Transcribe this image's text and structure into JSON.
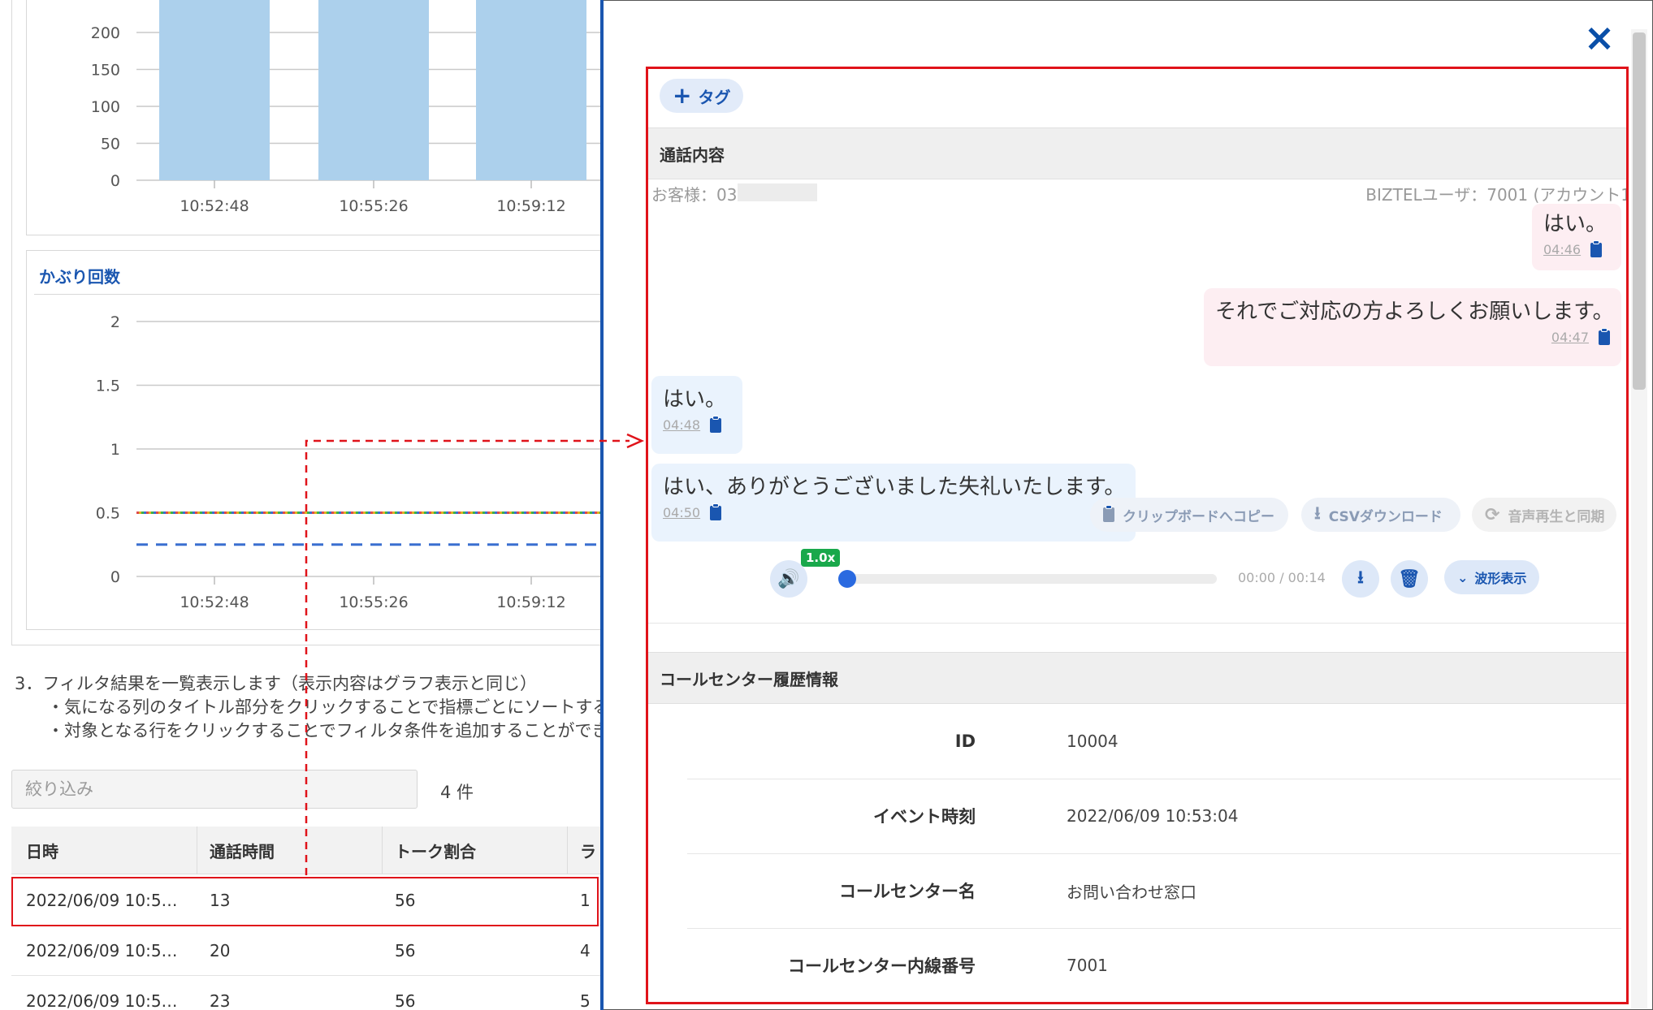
{
  "bar_chart": {
    "type": "bar",
    "yticks": [
      "200",
      "150",
      "100",
      "50",
      "0"
    ],
    "categories": [
      "10:52:48",
      "10:55:26",
      "10:59:12"
    ],
    "ylim": [
      0,
      200
    ],
    "bar_color": "#acd0ec"
  },
  "line_chart": {
    "type": "line",
    "title": "かぶり回数",
    "yticks": [
      "2",
      "1.5",
      "1",
      "0.5",
      "0"
    ],
    "categories": [
      "10:52:48",
      "10:55:26",
      "10:59:12"
    ],
    "ylim": [
      0,
      2
    ],
    "series": [
      {
        "style": "dotted-multicolor",
        "values": [
          0.5,
          0.5,
          0.5
        ]
      },
      {
        "style": "dashed",
        "color": "#3a6fd0",
        "values": [
          0.25,
          0.25,
          0.25
        ]
      }
    ]
  },
  "instructions": {
    "line1": "3．フィルタ結果を一覧表示します（表示内容はグラフ表示と同じ）",
    "line2": "・気になる列のタイトル部分をクリックすることで指標ごとにソートするこ",
    "line3": "・対象となる行をクリックすることでフィルタ条件を追加することができま"
  },
  "filter": {
    "placeholder": "絞り込み",
    "count": "4 件"
  },
  "table": {
    "headers": [
      "日時",
      "通話時間",
      "トーク割合",
      "ラ"
    ],
    "rows": [
      [
        "2022/06/09 10:5…",
        "13",
        "56",
        "1"
      ],
      [
        "2022/06/09 10:5…",
        "20",
        "56",
        "4"
      ],
      [
        "2022/06/09 10:5…",
        "23",
        "56",
        "5"
      ]
    ]
  },
  "modal": {
    "close_icon": "×",
    "tag_button": "タグ",
    "call_section_title": "通話内容",
    "customer_label": "お客様：03",
    "agent_label": "BIZTELユーザ：7001 (アカウント1",
    "messages": [
      {
        "speaker": "agent",
        "text": "はい。",
        "time": "04:46"
      },
      {
        "speaker": "agent",
        "text": "それでご対応の方よろしくお願いします。",
        "time": "04:47"
      },
      {
        "speaker": "customer",
        "text": "はい。",
        "time": "04:48"
      },
      {
        "speaker": "customer",
        "text": "はい、ありがとうございました失礼いたします。",
        "time": "04:50"
      }
    ],
    "actions": {
      "copy": "クリップボードへコピー",
      "csv": "CSVダウンロード",
      "sync": "音声再生と同期"
    },
    "player": {
      "speed": "1.0x",
      "time": "00:00 / 00:14",
      "waveform": "波形表示",
      "progress": 0
    },
    "history_section_title": "コールセンター履歴情報",
    "history": [
      {
        "label": "ID",
        "value": "10004"
      },
      {
        "label": "イベント時刻",
        "value": "2022/06/09 10:53:04"
      },
      {
        "label": "コールセンター名",
        "value": "お問い合わせ窓口"
      },
      {
        "label": "コールセンター内線番号",
        "value": "7001"
      }
    ]
  },
  "colors": {
    "accent": "#1a56b0",
    "highlight": "#e0131a",
    "agent_bubble": "#fdeef2",
    "customer_bubble": "#eaf3fd",
    "speed_badge": "#19a84b"
  }
}
